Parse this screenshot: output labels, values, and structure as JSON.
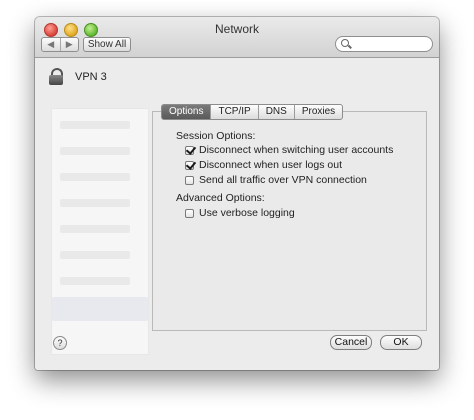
{
  "window": {
    "title": "Network"
  },
  "toolbar": {
    "back_label": "◀",
    "forward_label": "▶",
    "show_all_label": "Show All",
    "search_placeholder": ""
  },
  "connection": {
    "name": "VPN 3",
    "icon": "lock-icon"
  },
  "tabs": [
    {
      "label": "Options",
      "active": true
    },
    {
      "label": "TCP/IP",
      "active": false
    },
    {
      "label": "DNS",
      "active": false
    },
    {
      "label": "Proxies",
      "active": false
    }
  ],
  "session": {
    "heading": "Session Options:",
    "options": [
      {
        "label": "Disconnect when switching user accounts",
        "checked": true
      },
      {
        "label": "Disconnect when user logs out",
        "checked": true
      },
      {
        "label": "Send all traffic over VPN connection",
        "checked": false
      }
    ]
  },
  "advanced": {
    "heading": "Advanced Options:",
    "options": [
      {
        "label": "Use verbose logging",
        "checked": false
      }
    ]
  },
  "footer": {
    "help_label": "?",
    "cancel_label": "Cancel",
    "ok_label": "OK"
  }
}
